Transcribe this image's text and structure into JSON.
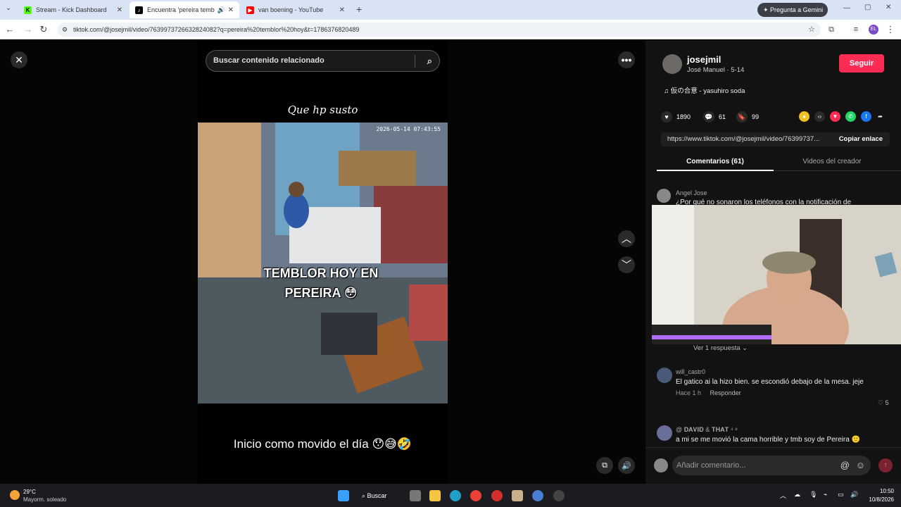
{
  "browser": {
    "tabs": [
      {
        "title": "Stream - Kick Dashboard",
        "favicon": "kick-icon",
        "color": "#53fc18"
      },
      {
        "title": "Encuentra 'pereira temblor",
        "favicon": "tiktok-icon",
        "color": "#000000",
        "active": true
      },
      {
        "title": "van boening - YouTube",
        "favicon": "youtube-icon",
        "color": "#ff0000"
      }
    ],
    "gemini_label": "Pregunta a Gemini",
    "url": "tiktok.com/@josejmil/video/7639973726632824082?q=pereira%20temblor%20hoy&t=1786376820489"
  },
  "video": {
    "search_placeholder": "Buscar contenido relacionado",
    "caption_top": "Que hp susto",
    "overlay_line1": "TEMBLOR HOY EN",
    "overlay_line2": "PEREIRA 😳",
    "timestamp": "2026-05-14 07:43:55",
    "caption_bottom": "Inicio como movido el día 😯😅🤣"
  },
  "creator": {
    "username": "josejmil",
    "display": "José Manuel · 5-14",
    "follow_label": "Seguir",
    "music": "♫  仮の合意 - yasuhiro soda"
  },
  "stats": {
    "likes": "1890",
    "comments": "61",
    "saves": "99"
  },
  "share": {
    "link": "https://www.tiktok.com/@josejmil/video/76399737...",
    "copy_label": "Copiar enlace"
  },
  "tabs": {
    "comments": "Comentarios (61)",
    "creator_videos": "Videos del creador"
  },
  "comments": [
    {
      "user": "Angel Jose",
      "text": "¿Por qué no sonaron los teléfonos con la notificación de"
    },
    {
      "user": "will_castr0",
      "text": "El gatico ai la hizo bien. se escondió debajo de la mesa. jeje",
      "time": "Hace 1 h",
      "reply": "Responder",
      "likes": "5"
    },
    {
      "user": "@ 𝐃𝐀𝐕𝐈𝐃 & 𝐓𝐇𝐀𝐓 ⁴ ⁸",
      "text": "a mi se me movió la cama horrible y tmb soy de Pereira 🙁"
    }
  ],
  "view_replies": "Ver 1 respuesta ⌄",
  "comment_placeholder": "Añadir comentario...",
  "taskbar": {
    "weather_temp": "29°C",
    "weather_desc": "Mayorm. soleado",
    "search_label": "Buscar",
    "time": "10:50",
    "date": "10/8/2026"
  }
}
